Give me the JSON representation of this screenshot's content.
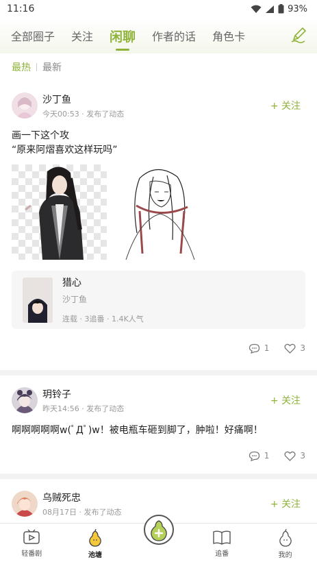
{
  "status": {
    "time": "11:16",
    "battery": "93%"
  },
  "tabs": [
    {
      "label": "全部圈子"
    },
    {
      "label": "关注"
    },
    {
      "label": "闲聊"
    },
    {
      "label": "作者的话"
    },
    {
      "label": "角色卡"
    }
  ],
  "sort": {
    "hot": "最热",
    "new": "最新"
  },
  "posts": [
    {
      "author": "沙丁鱼",
      "time": "今天00:53 · 发布了动态",
      "follow": "+ 关注",
      "text_line1": "画一下这个攻",
      "text_line2": "“原来阿熠喜欢这样玩吗”",
      "card": {
        "title": "猎心",
        "author": "沙丁鱼",
        "stats": "连载 · 3追番 · 1.4K人气"
      },
      "comments": "1",
      "likes": "3"
    },
    {
      "author": "玥铃子",
      "time": "昨天14:56 · 发布了动态",
      "follow": "+ 关注",
      "text": "啊啊啊啊啊w(ﾟДﾟ)w！被电瓶车砸到脚了，肿啦！好痛啊！",
      "comments": "1",
      "likes": "3"
    },
    {
      "author": "乌贼死忠",
      "time": "08月17日 · 发布了动态",
      "follow": "+ 关注"
    }
  ],
  "nav": [
    {
      "label": "轻番剧",
      "icon": "tv-icon"
    },
    {
      "label": "池塘",
      "icon": "pear-icon"
    },
    {
      "label": "追番",
      "icon": "book-icon"
    },
    {
      "label": "我的",
      "icon": "profile-icon"
    }
  ],
  "colors": {
    "accent": "#8fb339"
  }
}
